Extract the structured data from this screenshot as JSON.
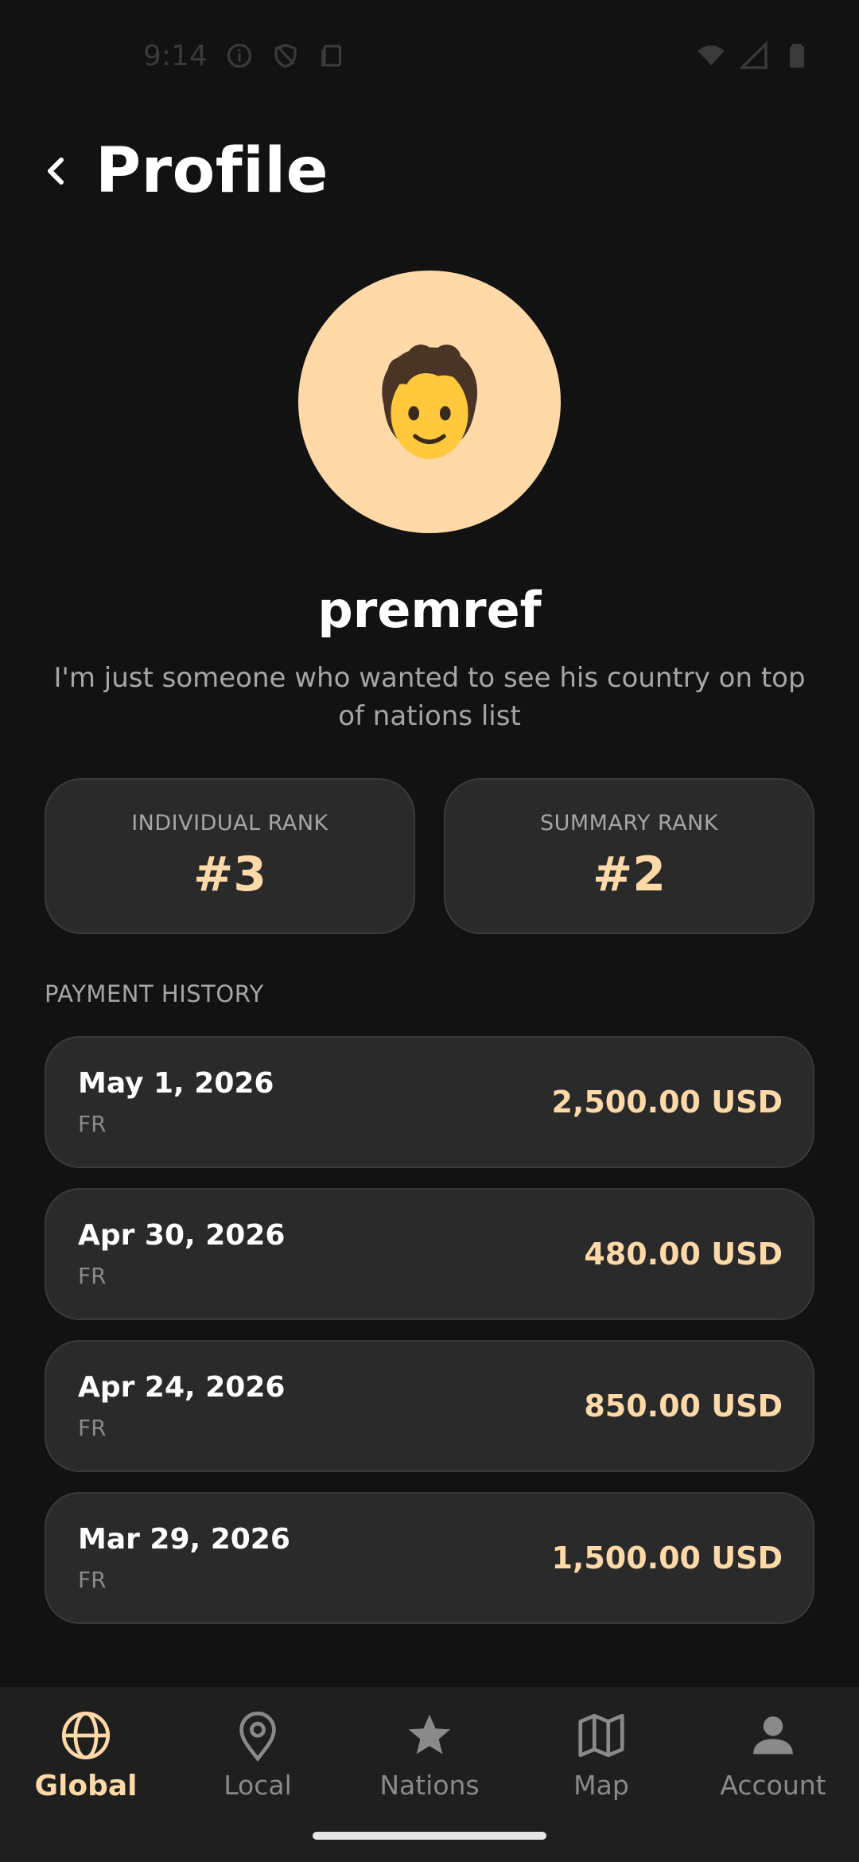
{
  "status_bar": {
    "time": "9:14",
    "icons": [
      "info-icon",
      "shield-icon",
      "clipboard-icon",
      "wifi-icon",
      "signal-icon",
      "battery-icon"
    ]
  },
  "header": {
    "back_icon": "chevron-left-icon",
    "title": "Profile"
  },
  "profile": {
    "avatar_emoji": "🧑",
    "avatar_color": "#FFDAA8",
    "username": "premref",
    "bio": "I'm just someone who wanted to see his country on top of nations list"
  },
  "ranks": {
    "individual": {
      "label": "INDIVIDUAL RANK",
      "value": "#3"
    },
    "summary": {
      "label": "SUMMARY RANK",
      "value": "#2"
    }
  },
  "payment_history": {
    "title": "PAYMENT HISTORY",
    "items": [
      {
        "date": "May 1, 2026",
        "country": "FR",
        "amount": "2,500.00 USD"
      },
      {
        "date": "Apr 30, 2026",
        "country": "FR",
        "amount": "480.00 USD"
      },
      {
        "date": "Apr 24, 2026",
        "country": "FR",
        "amount": "850.00 USD"
      },
      {
        "date": "Mar 29, 2026",
        "country": "FR",
        "amount": "1,500.00 USD"
      }
    ]
  },
  "bottom_nav": {
    "active": "Global",
    "items": [
      {
        "label": "Global",
        "icon": "globe-icon"
      },
      {
        "label": "Local",
        "icon": "location-pin-icon"
      },
      {
        "label": "Nations",
        "icon": "star-icon"
      },
      {
        "label": "Map",
        "icon": "map-icon"
      },
      {
        "label": "Account",
        "icon": "person-icon"
      }
    ]
  },
  "colors": {
    "background": "#121212",
    "card": "#2a2a2a",
    "accent": "#FFDAA8",
    "muted_text": "#a6a6a6"
  }
}
